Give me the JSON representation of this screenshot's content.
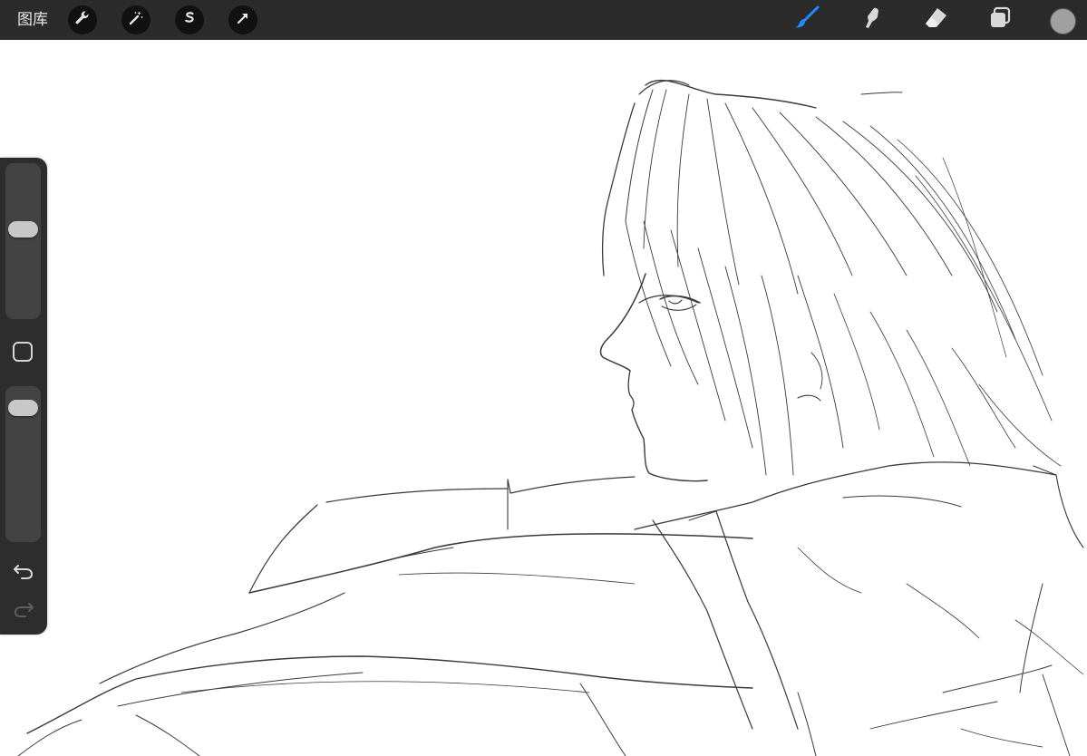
{
  "topbar": {
    "gallery_label": "图库",
    "left_tools": [
      "wrench-icon",
      "magic-wand-icon",
      "selection-s-icon",
      "transform-arrow-icon"
    ],
    "right_tools": [
      "brush-icon",
      "smudge-icon",
      "eraser-icon",
      "layers-icon"
    ],
    "active_tool": "brush-icon",
    "accent_color": "#1e8cff",
    "current_color": "#a0a0a0"
  },
  "sidebar": {
    "brush_size_level": 0.59,
    "opacity_level": 0.92,
    "controls": [
      "brush-size-slider",
      "modify-button",
      "opacity-slider",
      "undo-icon",
      "redo-icon"
    ]
  },
  "canvas": {
    "background": "#ffffff",
    "stroke_color": "#3a3a3a"
  }
}
